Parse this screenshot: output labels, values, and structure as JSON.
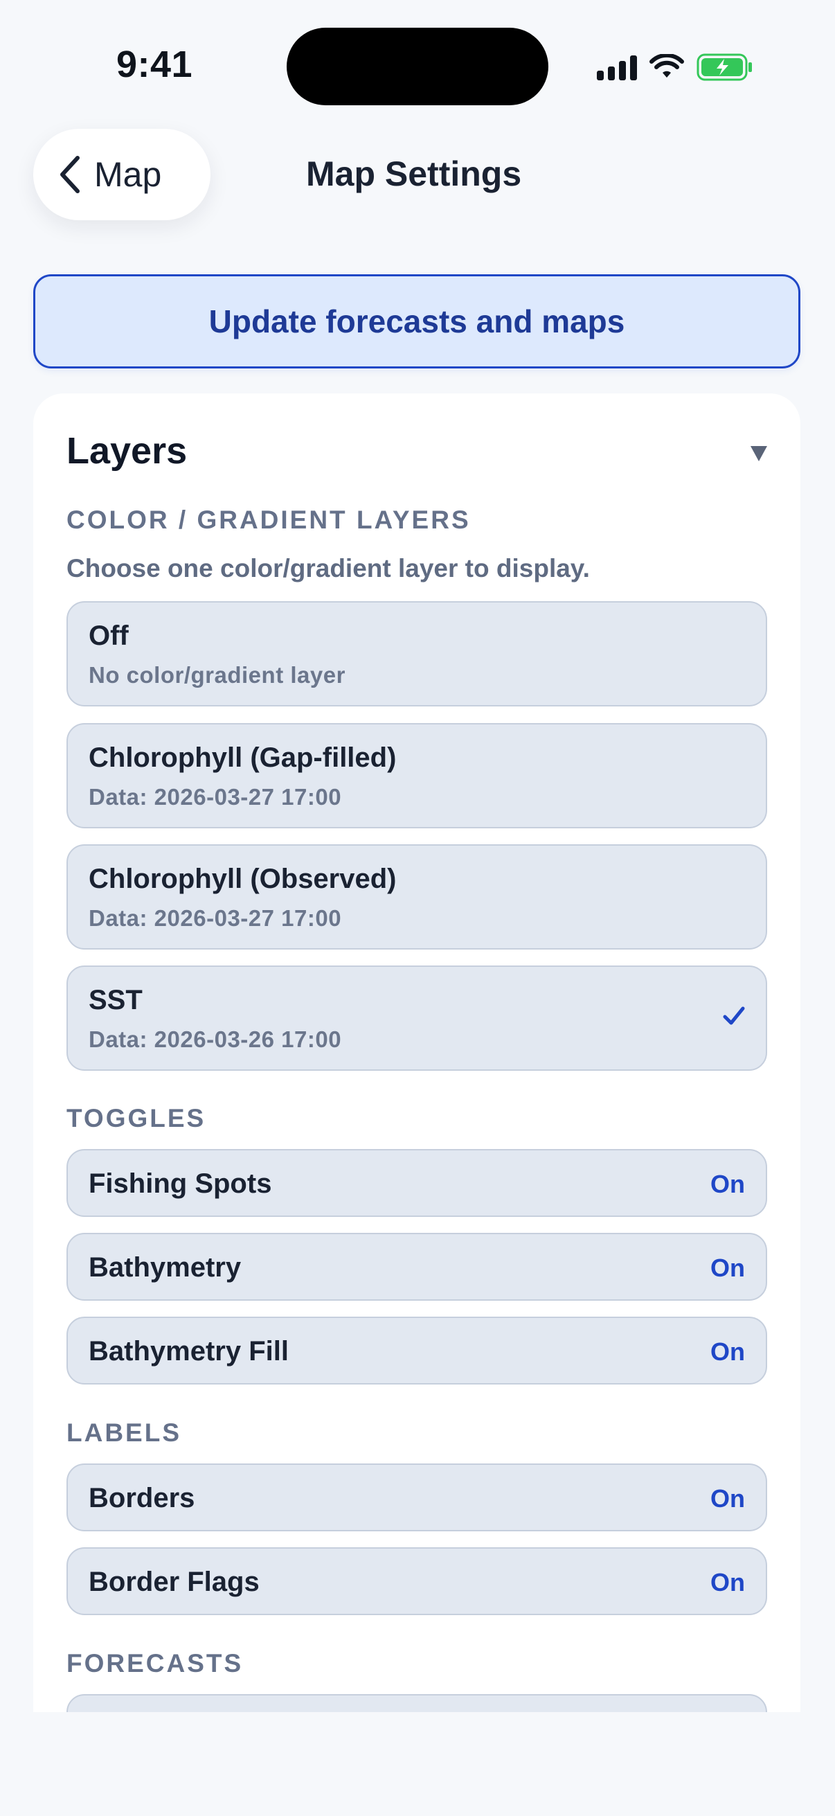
{
  "status_bar": {
    "time": "9:41"
  },
  "nav": {
    "back_label": "Map",
    "title": "Map Settings"
  },
  "update_button": {
    "label": "Update forecasts and maps"
  },
  "layers_card": {
    "title": "Layers",
    "color_section": {
      "label": "COLOR / GRADIENT LAYERS",
      "description": "Choose one color/gradient layer to display.",
      "options": [
        {
          "title": "Off",
          "subtitle": "No color/gradient layer",
          "selected": false
        },
        {
          "title": "Chlorophyll (Gap-filled)",
          "subtitle": "Data: 2026-03-27 17:00",
          "selected": false
        },
        {
          "title": "Chlorophyll (Observed)",
          "subtitle": "Data: 2026-03-27 17:00",
          "selected": false
        },
        {
          "title": "SST",
          "subtitle": "Data: 2026-03-26 17:00",
          "selected": true
        }
      ]
    },
    "toggles_section": {
      "label": "TOGGLES",
      "items": [
        {
          "title": "Fishing Spots",
          "state": "On"
        },
        {
          "title": "Bathymetry",
          "state": "On"
        },
        {
          "title": "Bathymetry Fill",
          "state": "On"
        }
      ]
    },
    "labels_section": {
      "label": "LABELS",
      "items": [
        {
          "title": "Borders",
          "state": "On"
        },
        {
          "title": "Border Flags",
          "state": "On"
        }
      ]
    },
    "forecasts_section": {
      "label": "FORECASTS"
    }
  },
  "colors": {
    "accent": "#1f47c7",
    "row_bg": "#e2e8f1",
    "page_bg": "#f6f8fb"
  }
}
